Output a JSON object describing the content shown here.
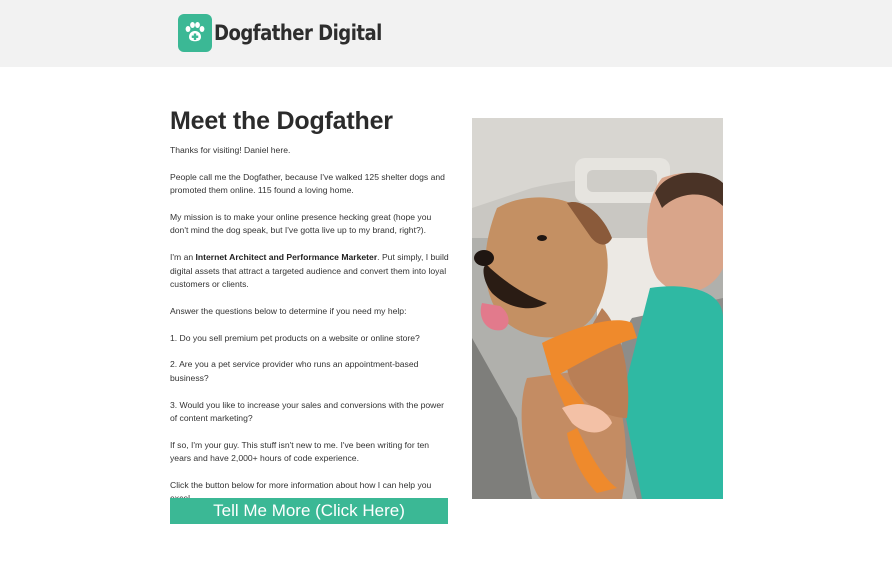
{
  "header": {
    "brand": "Dogfather Digital",
    "logo_icon": "paw-cross-icon"
  },
  "main": {
    "title": "Meet the Dogfather",
    "p1": "Thanks for visiting! Daniel here.",
    "p2": "People call me the Dogfather, because I've walked 125 shelter dogs and promoted them online. 115 found a loving home.",
    "p3": "My mission is to make your online presence hecking great (hope you don't mind the dog speak, but I've gotta live up to my brand, right?).",
    "p4_pre": "I'm an ",
    "p4_bold": "Internet Architect and Performance Marketer",
    "p4_post": ". Put simply, I build digital assets that attract a targeted audience and convert them into loyal customers or clients.",
    "p5": "Answer the questions below to determine if you need my help:",
    "q1": "1. Do you sell premium pet products on a website or online store?",
    "q2": "2. Are you a pet service provider who runs an appointment-based business?",
    "q3": "3. Would you like to increase your sales and conversions with the power of content marketing?",
    "p6": "If so, I'm your guy. This stuff isn't new to me. I've been writing for ten years and have 2,000+ hours of code experience.",
    "p7": "Click the button below for more information about how I can help you excel.",
    "cta_label": "Tell Me More (Click Here)"
  },
  "colors": {
    "accent": "#3bb895",
    "header_bg": "#f2f2f2",
    "text": "#333333"
  }
}
